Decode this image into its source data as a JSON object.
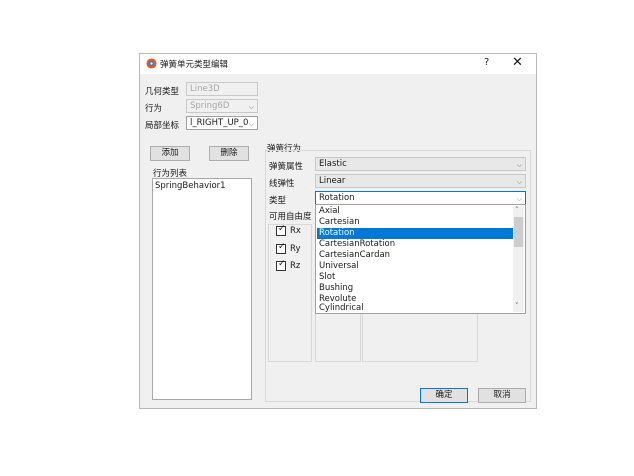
{
  "dialog": {
    "title": "弹簧单元类型编辑",
    "help": "?",
    "close": "✕"
  },
  "left": {
    "geometry_label": "几何类型",
    "geometry_value": "Line3D",
    "behavior_label": "行为",
    "behavior_value": "Spring6D",
    "coord_label": "局部坐标",
    "coord_value": "l_RIGHT_UP_0",
    "add_button": "添加",
    "delete_button": "删除",
    "list_title": "行为列表",
    "list_items": [
      "SpringBehavior1"
    ]
  },
  "right": {
    "group_title": "弹簧行为",
    "spring_prop_label": "弹簧属性",
    "spring_prop_value": "Elastic",
    "linear_label": "线弹性",
    "linear_value": "Linear",
    "type_label": "类型",
    "type_value": "Rotation",
    "dof_label": "可用自由度",
    "dofs": [
      {
        "label": "Rx",
        "checked": true
      },
      {
        "label": "Ry",
        "checked": true
      },
      {
        "label": "Rz",
        "checked": true
      }
    ]
  },
  "type_options": [
    "Axial",
    "Cartesian",
    "Rotation",
    "CartesianRotation",
    "CartesianCardan",
    "Universal",
    "Slot",
    "Bushing",
    "Revolute",
    "Cylindrical"
  ],
  "selected_option": "Rotation",
  "footer": {
    "ok": "确定",
    "cancel": "取消"
  },
  "colors": {
    "accent": "#0078d7",
    "selection": "#0078d7",
    "dialog_bg": "#f0f0f0"
  }
}
